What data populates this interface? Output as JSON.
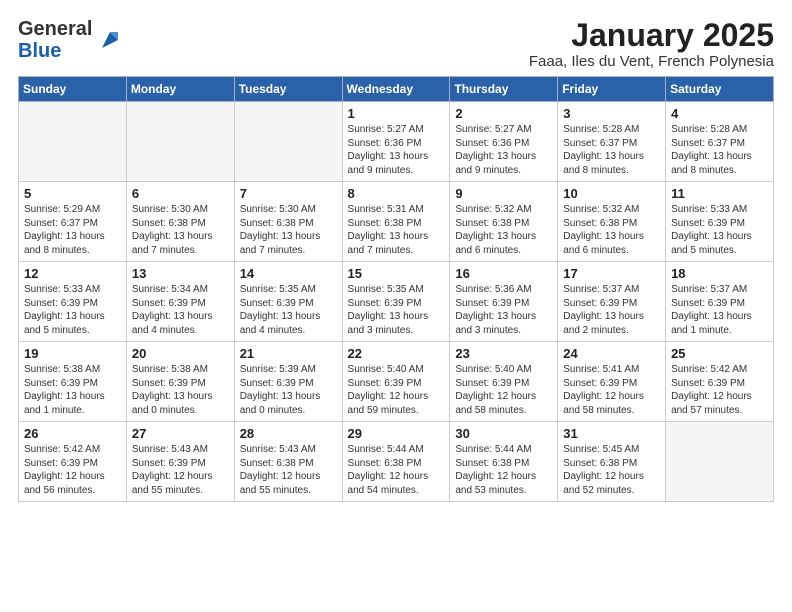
{
  "logo": {
    "general": "General",
    "blue": "Blue"
  },
  "header": {
    "title": "January 2025",
    "subtitle": "Faaa, Iles du Vent, French Polynesia"
  },
  "weekdays": [
    "Sunday",
    "Monday",
    "Tuesday",
    "Wednesday",
    "Thursday",
    "Friday",
    "Saturday"
  ],
  "weeks": [
    [
      {
        "day": "",
        "info": ""
      },
      {
        "day": "",
        "info": ""
      },
      {
        "day": "",
        "info": ""
      },
      {
        "day": "1",
        "info": "Sunrise: 5:27 AM\nSunset: 6:36 PM\nDaylight: 13 hours and 9 minutes."
      },
      {
        "day": "2",
        "info": "Sunrise: 5:27 AM\nSunset: 6:36 PM\nDaylight: 13 hours and 9 minutes."
      },
      {
        "day": "3",
        "info": "Sunrise: 5:28 AM\nSunset: 6:37 PM\nDaylight: 13 hours and 8 minutes."
      },
      {
        "day": "4",
        "info": "Sunrise: 5:28 AM\nSunset: 6:37 PM\nDaylight: 13 hours and 8 minutes."
      }
    ],
    [
      {
        "day": "5",
        "info": "Sunrise: 5:29 AM\nSunset: 6:37 PM\nDaylight: 13 hours and 8 minutes."
      },
      {
        "day": "6",
        "info": "Sunrise: 5:30 AM\nSunset: 6:38 PM\nDaylight: 13 hours and 7 minutes."
      },
      {
        "day": "7",
        "info": "Sunrise: 5:30 AM\nSunset: 6:38 PM\nDaylight: 13 hours and 7 minutes."
      },
      {
        "day": "8",
        "info": "Sunrise: 5:31 AM\nSunset: 6:38 PM\nDaylight: 13 hours and 7 minutes."
      },
      {
        "day": "9",
        "info": "Sunrise: 5:32 AM\nSunset: 6:38 PM\nDaylight: 13 hours and 6 minutes."
      },
      {
        "day": "10",
        "info": "Sunrise: 5:32 AM\nSunset: 6:38 PM\nDaylight: 13 hours and 6 minutes."
      },
      {
        "day": "11",
        "info": "Sunrise: 5:33 AM\nSunset: 6:39 PM\nDaylight: 13 hours and 5 minutes."
      }
    ],
    [
      {
        "day": "12",
        "info": "Sunrise: 5:33 AM\nSunset: 6:39 PM\nDaylight: 13 hours and 5 minutes."
      },
      {
        "day": "13",
        "info": "Sunrise: 5:34 AM\nSunset: 6:39 PM\nDaylight: 13 hours and 4 minutes."
      },
      {
        "day": "14",
        "info": "Sunrise: 5:35 AM\nSunset: 6:39 PM\nDaylight: 13 hours and 4 minutes."
      },
      {
        "day": "15",
        "info": "Sunrise: 5:35 AM\nSunset: 6:39 PM\nDaylight: 13 hours and 3 minutes."
      },
      {
        "day": "16",
        "info": "Sunrise: 5:36 AM\nSunset: 6:39 PM\nDaylight: 13 hours and 3 minutes."
      },
      {
        "day": "17",
        "info": "Sunrise: 5:37 AM\nSunset: 6:39 PM\nDaylight: 13 hours and 2 minutes."
      },
      {
        "day": "18",
        "info": "Sunrise: 5:37 AM\nSunset: 6:39 PM\nDaylight: 13 hours and 1 minute."
      }
    ],
    [
      {
        "day": "19",
        "info": "Sunrise: 5:38 AM\nSunset: 6:39 PM\nDaylight: 13 hours and 1 minute."
      },
      {
        "day": "20",
        "info": "Sunrise: 5:38 AM\nSunset: 6:39 PM\nDaylight: 13 hours and 0 minutes."
      },
      {
        "day": "21",
        "info": "Sunrise: 5:39 AM\nSunset: 6:39 PM\nDaylight: 13 hours and 0 minutes."
      },
      {
        "day": "22",
        "info": "Sunrise: 5:40 AM\nSunset: 6:39 PM\nDaylight: 12 hours and 59 minutes."
      },
      {
        "day": "23",
        "info": "Sunrise: 5:40 AM\nSunset: 6:39 PM\nDaylight: 12 hours and 58 minutes."
      },
      {
        "day": "24",
        "info": "Sunrise: 5:41 AM\nSunset: 6:39 PM\nDaylight: 12 hours and 58 minutes."
      },
      {
        "day": "25",
        "info": "Sunrise: 5:42 AM\nSunset: 6:39 PM\nDaylight: 12 hours and 57 minutes."
      }
    ],
    [
      {
        "day": "26",
        "info": "Sunrise: 5:42 AM\nSunset: 6:39 PM\nDaylight: 12 hours and 56 minutes."
      },
      {
        "day": "27",
        "info": "Sunrise: 5:43 AM\nSunset: 6:39 PM\nDaylight: 12 hours and 55 minutes."
      },
      {
        "day": "28",
        "info": "Sunrise: 5:43 AM\nSunset: 6:38 PM\nDaylight: 12 hours and 55 minutes."
      },
      {
        "day": "29",
        "info": "Sunrise: 5:44 AM\nSunset: 6:38 PM\nDaylight: 12 hours and 54 minutes."
      },
      {
        "day": "30",
        "info": "Sunrise: 5:44 AM\nSunset: 6:38 PM\nDaylight: 12 hours and 53 minutes."
      },
      {
        "day": "31",
        "info": "Sunrise: 5:45 AM\nSunset: 6:38 PM\nDaylight: 12 hours and 52 minutes."
      },
      {
        "day": "",
        "info": ""
      }
    ]
  ]
}
